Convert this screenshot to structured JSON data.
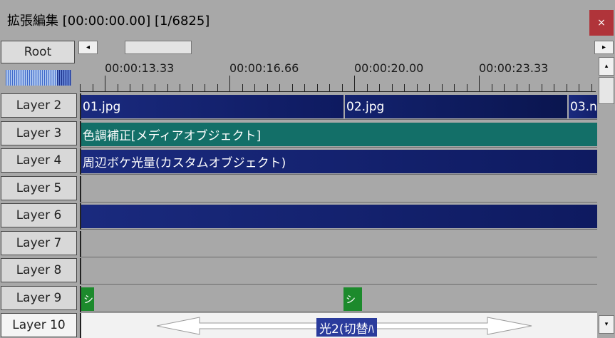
{
  "window": {
    "title": "拡張編集 [00:00:00.00] [1/6825]",
    "close_glyph": "×"
  },
  "root_button": "Root",
  "scroll": {
    "left_glyph": "◂",
    "right_glyph": "▸",
    "up_glyph": "▴",
    "down_glyph": "▾"
  },
  "ruler": {
    "labels": [
      "00:00:13.33",
      "00:00:16.66",
      "00:00:20.00",
      "00:00:23.33"
    ]
  },
  "layers": [
    {
      "label": "Layer 2"
    },
    {
      "label": "Layer 3"
    },
    {
      "label": "Layer 4"
    },
    {
      "label": "Layer 5"
    },
    {
      "label": "Layer 6"
    },
    {
      "label": "Layer 7"
    },
    {
      "label": "Layer 8"
    },
    {
      "label": "Layer 9"
    },
    {
      "label": "Layer 10"
    }
  ],
  "clips": {
    "layer2": [
      "01.jpg",
      "02.jpg",
      "03.n"
    ],
    "layer3": "色調補正[メディアオブジェクト]",
    "layer4": "周辺ボケ光量(カスタムオブジェクト)",
    "layer9": [
      "シ",
      "シ"
    ],
    "layer10_transition": "光2(切替ﾊ"
  },
  "colors": {
    "media_clip": "#1a2a7e",
    "filter_clip": "#136f68",
    "audio_clip": "#1c8a2c",
    "close_button": "#b0343a",
    "background": "#a8a8a8"
  }
}
